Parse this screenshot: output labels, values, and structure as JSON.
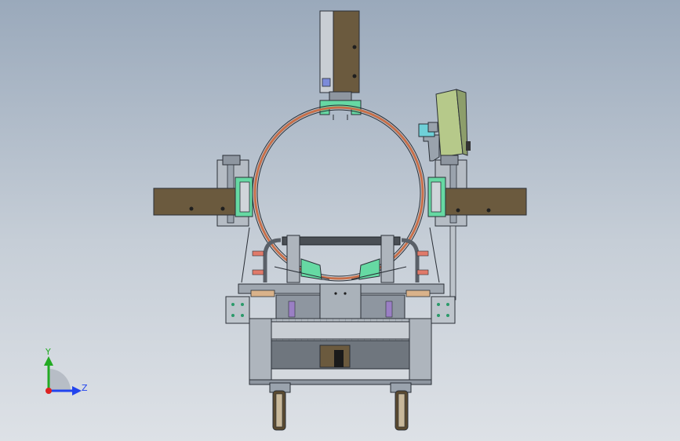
{
  "viewport": {
    "background_top": "#9aa9bb",
    "background_bottom": "#dde1e6"
  },
  "triad": {
    "y_label": "Y",
    "z_label": "Z",
    "y_color": "#22aa22",
    "z_color": "#2244ee",
    "origin_color": "#dd2222"
  },
  "colors": {
    "brown_block": "#6b5a3e",
    "ring": "#c8704a",
    "frame": "#b9c0c8",
    "green_part": "#66d9a3",
    "dark_line": "#2a2f36"
  }
}
